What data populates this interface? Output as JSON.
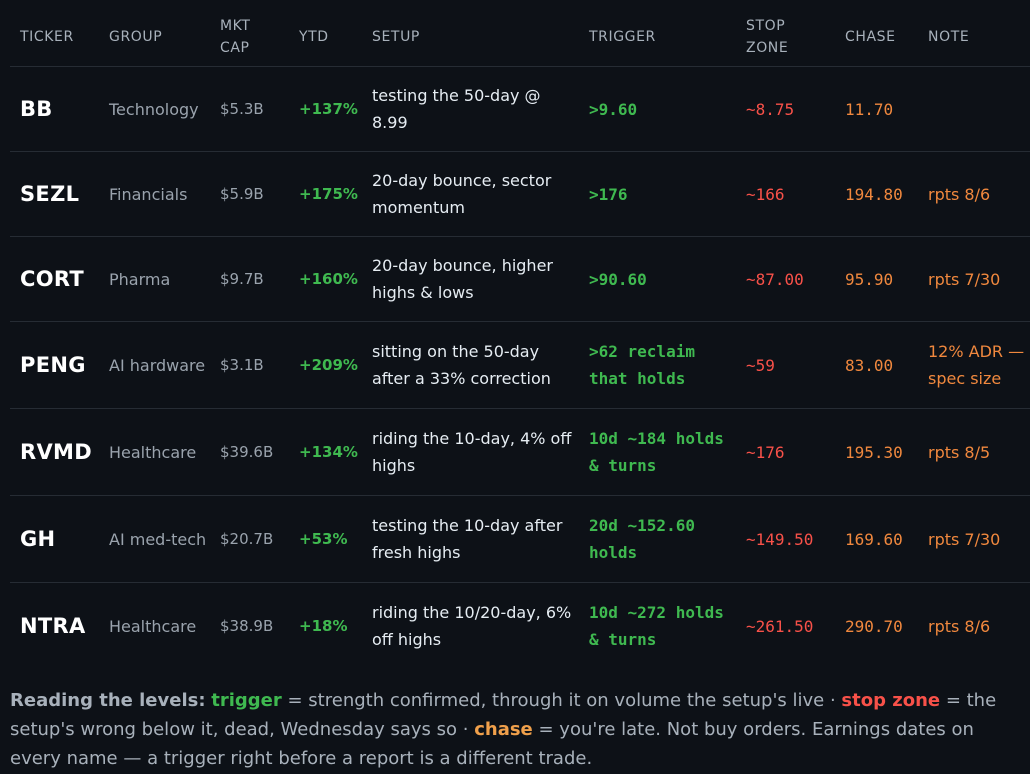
{
  "headers": {
    "ticker": "TICKER",
    "group": "GROUP",
    "mktcap_1": "MKT",
    "mktcap_2": "CAP",
    "ytd": "YTD",
    "setup": "SETUP",
    "trigger": "TRIGGER",
    "stop_1": "STOP",
    "stop_2": "ZONE",
    "chase": "CHASE",
    "note": "NOTE"
  },
  "rows": [
    {
      "ticker": "BB",
      "group": "Technology",
      "cap": "$5.3B",
      "ytd": "+137%",
      "setup": "testing the 50-day @ 8.99",
      "trigger": ">9.60",
      "stop": "~8.75",
      "chase": "11.70",
      "note": ""
    },
    {
      "ticker": "SEZL",
      "group": "Financials",
      "cap": "$5.9B",
      "ytd": "+175%",
      "setup": "20-day bounce, sector momentum",
      "trigger": ">176",
      "stop": "~166",
      "chase": "194.80",
      "note": "rpts 8/6"
    },
    {
      "ticker": "CORT",
      "group": "Pharma",
      "cap": "$9.7B",
      "ytd": "+160%",
      "setup": "20-day bounce, higher highs & lows",
      "trigger": ">90.60",
      "stop": "~87.00",
      "chase": "95.90",
      "note": "rpts 7/30"
    },
    {
      "ticker": "PENG",
      "group": "AI hardware",
      "cap": "$3.1B",
      "ytd": "+209%",
      "setup": "sitting on the 50-day after a 33% correction",
      "trigger": ">62 reclaim that holds",
      "stop": "~59",
      "chase": "83.00",
      "note": "12% ADR — spec size"
    },
    {
      "ticker": "RVMD",
      "group": "Healthcare",
      "cap": "$39.6B",
      "ytd": "+134%",
      "setup": "riding the 10-day, 4% off highs",
      "trigger": "10d ~184 holds & turns",
      "stop": "~176",
      "chase": "195.30",
      "note": "rpts 8/5"
    },
    {
      "ticker": "GH",
      "group": "AI med-tech",
      "cap": "$20.7B",
      "ytd": "+53%",
      "setup": "testing the 10-day after fresh highs",
      "trigger": "20d ~152.60 holds",
      "stop": "~149.50",
      "chase": "169.60",
      "note": "rpts 7/30"
    },
    {
      "ticker": "NTRA",
      "group": "Healthcare",
      "cap": "$38.9B",
      "ytd": "+18%",
      "setup": "riding the 10/20-day, 6% off highs",
      "trigger": "10d ~272 holds & turns",
      "stop": "~261.50",
      "chase": "290.70",
      "note": "rpts 8/6"
    }
  ],
  "legend": {
    "heading": "Reading the levels:",
    "trigger_key": "trigger",
    "trigger_text": " = strength confirmed, through it on volume the setup's live · ",
    "stop_key": "stop zone",
    "stop_text": " = the setup's wrong below it, dead, Wednesday says so · ",
    "chase_key": "chase",
    "chase_text": " = you're late. Not buy orders. Earnings dates on every name — a trigger right before a report is a different trade."
  },
  "colors": {
    "background": "#0d1117",
    "trigger": "#3fb950",
    "stop": "#f85149",
    "chase": "#f0883e"
  }
}
